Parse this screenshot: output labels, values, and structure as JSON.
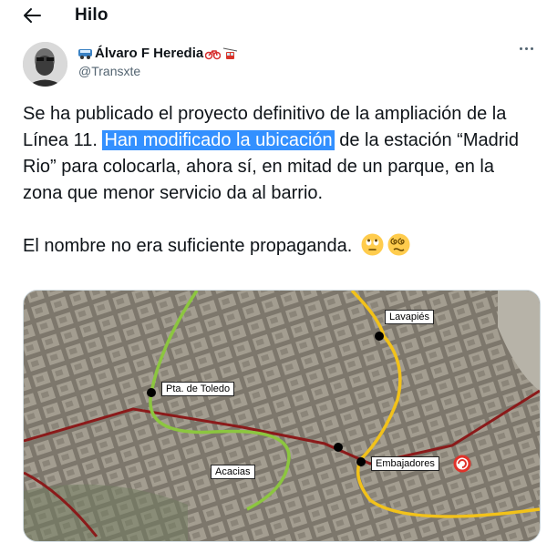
{
  "header": {
    "title": "Hilo"
  },
  "author": {
    "name": "Álvaro F Heredia",
    "handle": "@Transxte"
  },
  "tweet": {
    "part1": "Se ha publicado el proyecto definitivo de la ampliación de la Línea 11. ",
    "highlight": "Han modificado la ubicación",
    "part2": " de la estación “Madrid Rio” para colocarla, ahora sí, en mitad de un parque, en la zona que menor servicio da al barrio.",
    "line2": "El nombre no era suficiente propaganda."
  },
  "map": {
    "labels": {
      "lavapies": "Lavapiés",
      "toledo": "Pta. de Toledo",
      "acacias": "Acacias",
      "embajadores": "Embajadores"
    }
  },
  "colors": {
    "highlight": "#3390ff",
    "line_yellow": "#f2c21a",
    "line_green": "#8cc63f",
    "line_red": "#8b1a1a"
  },
  "icons": [
    "back-arrow-icon",
    "bus-emoji",
    "bicycle-emoji",
    "cable-car-emoji",
    "more-options-icon",
    "rolling-eyes-emoji",
    "dizzy-face-emoji"
  ]
}
